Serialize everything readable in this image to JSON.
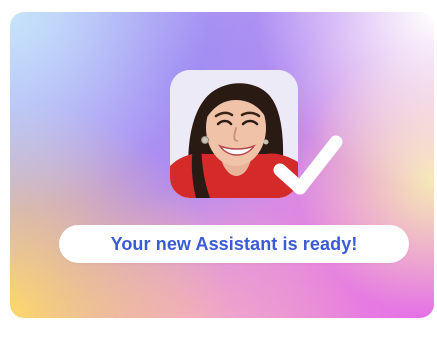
{
  "banner": {
    "message": "Your new Assistant is ready!"
  },
  "colors": {
    "message_text": "#3b5bd6",
    "pill_background": "#ffffff",
    "checkmark": "#ffffff"
  },
  "icons": {
    "status": "checkmark-icon"
  }
}
